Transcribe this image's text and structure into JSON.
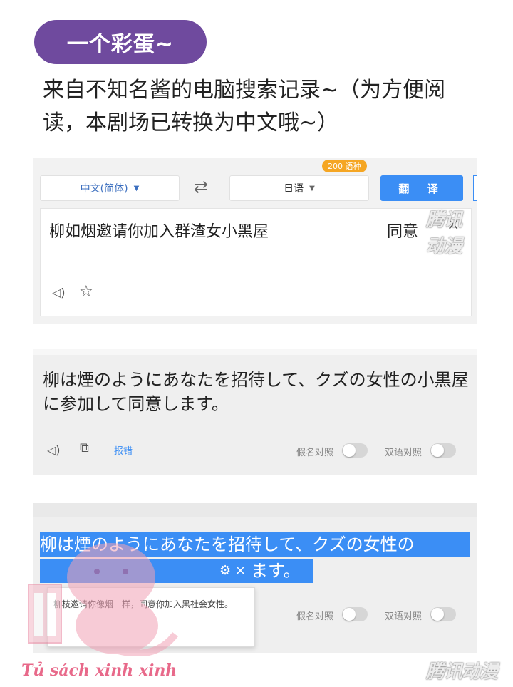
{
  "header": {
    "pill_label": "一个彩蛋~",
    "intro_text": "来自不知名酱的电脑搜索记录~（为方便阅读，本剧场已转换为中文哦~）"
  },
  "translator": {
    "source_lang": "中文(简体)",
    "target_lang": "日语",
    "badge": "200 语种",
    "translate_button": "翻 译",
    "input_text": "柳如烟邀请你加入群渣女小黑屋",
    "agree_text": "同意",
    "close_glyph": "×"
  },
  "result": {
    "text": "柳は煙のようにあなたを招待して、クズの女性の小黒屋に参加して同意します。",
    "report_label": "报错",
    "toggle_kana": "假名对照",
    "toggle_bilingual": "双语对照"
  },
  "selection": {
    "line1": "柳は煙のようにあなたを招待して、クズの女性の",
    "line2_tail": "ます。",
    "tools": "⚙ ×",
    "popup_text": "柳枝邀请你像烟一样，同意你加入黑社会女性。",
    "toggle_kana": "假名对照",
    "toggle_bilingual": "双语对照"
  },
  "watermark": "腾讯动漫",
  "logo_text": "Tủ sách xinh xinh"
}
